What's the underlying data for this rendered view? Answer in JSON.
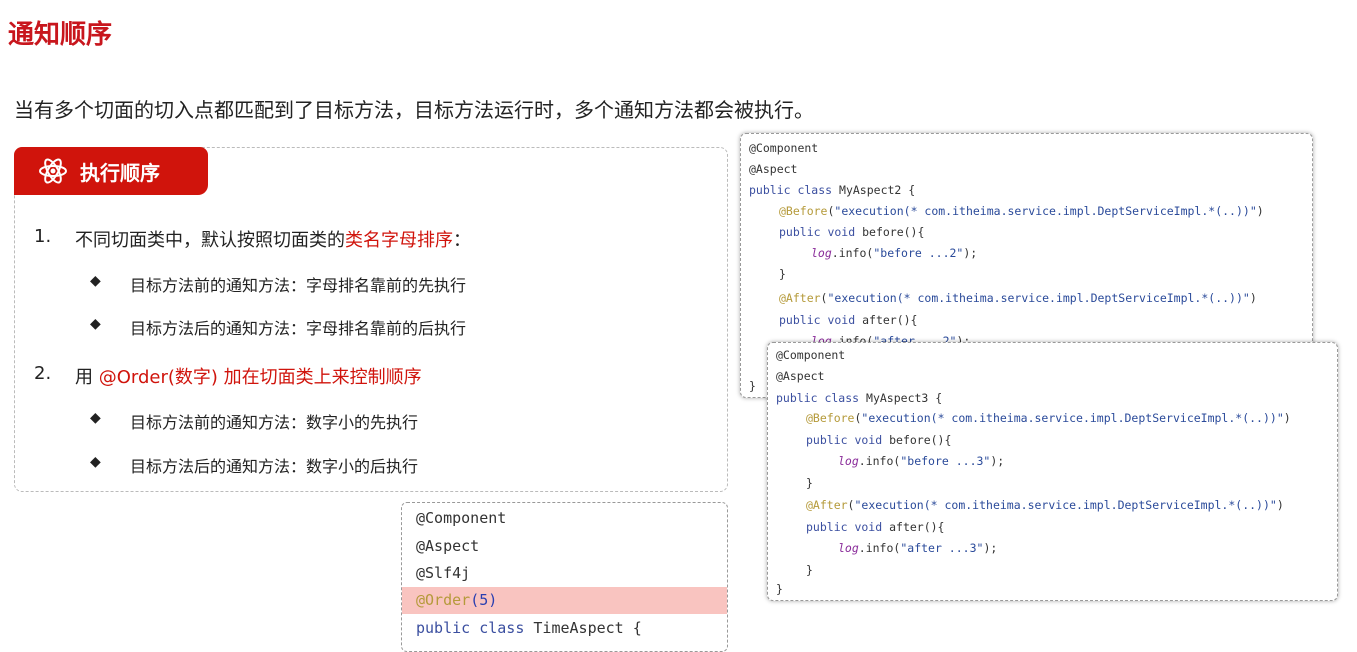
{
  "title": "通知顺序",
  "intro": "当有多个切面的切入点都匹配到了目标方法，目标方法运行时，多个通知方法都会被执行。",
  "panel": {
    "tab_icon": "atom-icon",
    "tab_label": "执行顺序",
    "items": [
      {
        "num": "1.",
        "text": "不同切面类中，默认按照切面类的",
        "highlight": "类名字母排序",
        "suffix": "：",
        "bullets": [
          "目标方法前的通知方法：字母排名靠前的先执行",
          "目标方法后的通知方法：字母排名靠前的后执行"
        ]
      },
      {
        "num": "2.",
        "text": "用 ",
        "highlight": "@Order(数字) 加在切面类上来控制顺序",
        "suffix": "",
        "bullets": [
          "目标方法前的通知方法：数字小的先执行",
          "目标方法后的通知方法：数字小的后执行"
        ]
      }
    ]
  },
  "code_time": {
    "lines": [
      "@Component",
      "@Aspect",
      "@Slf4j",
      "@Order",
      "(5)",
      "public class",
      "TimeAspect {"
    ],
    "highlight_color": "#f9c4c0"
  },
  "code_a2": {
    "class": "MyAspect2",
    "before_arg": "\"execution(* com.itheima.service.impl.DeptServiceImpl.*(..))\"",
    "before_log": "\"before ...2\"",
    "after_log": "\"after ...2\""
  },
  "code_a3": {
    "class": "MyAspect3",
    "before_arg": "\"execution(* com.itheima.service.impl.DeptServiceImpl.*(..))\"",
    "before_log": "\"before ...3\"",
    "after_log": "\"after ...3\""
  },
  "code_tokens": {
    "component": "@Component",
    "aspect": "@Aspect",
    "public_class": "public class",
    "brace_open": " {",
    "before_ann": "@Before",
    "after_ann": "@After",
    "public_void": "public void",
    "before_m": " before(){",
    "after_m": " after(){",
    "log": "log",
    ".info": ".info",
    "close": "}"
  },
  "colors": {
    "accent": "#d0140c",
    "annotation": "#b59a3a",
    "keyword": "#3b4fa0"
  }
}
